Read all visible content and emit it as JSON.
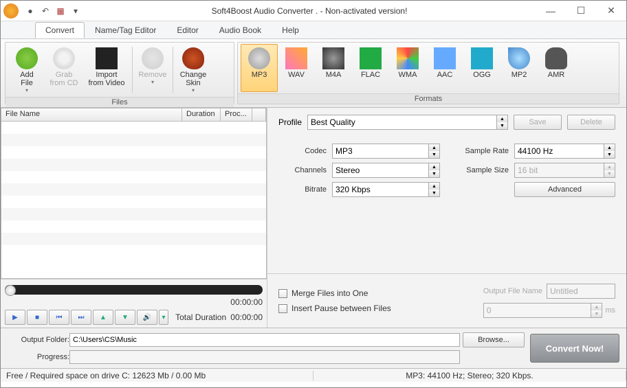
{
  "title": "Soft4Boost Audio Converter  . - Non-activated version!",
  "menu": {
    "tabs": [
      "Convert",
      "Name/Tag Editor",
      "Editor",
      "Audio Book",
      "Help"
    ],
    "active": 0
  },
  "ribbon": {
    "files_caption": "Files",
    "formats_caption": "Formats",
    "add_file": "Add\nFile",
    "grab_cd": "Grab\nfrom CD",
    "import_video": "Import\nfrom Video",
    "remove": "Remove",
    "change_skin": "Change\nSkin",
    "formats": [
      "MP3",
      "WAV",
      "M4A",
      "FLAC",
      "WMA",
      "AAC",
      "OGG",
      "MP2",
      "AMR"
    ],
    "selected_format": "MP3"
  },
  "filelist": {
    "col_name": "File Name",
    "col_duration": "Duration",
    "col_proc": "Proc..."
  },
  "playback": {
    "time": "00:00:00",
    "total_label": "Total Duration",
    "total_time": "00:00:00"
  },
  "settings": {
    "profile_label": "Profile",
    "profile_value": "Best Quality",
    "save": "Save",
    "delete": "Delete",
    "codec_label": "Codec",
    "codec_value": "MP3",
    "sample_rate_label": "Sample Rate",
    "sample_rate_value": "44100 Hz",
    "channels_label": "Channels",
    "channels_value": "Stereo",
    "sample_size_label": "Sample Size",
    "sample_size_value": "16 bit",
    "bitrate_label": "Bitrate",
    "bitrate_value": "320 Kbps",
    "advanced": "Advanced"
  },
  "options": {
    "merge": "Merge Files into One",
    "insert_pause": "Insert Pause between Files",
    "output_name_label": "Output File Name",
    "output_name_value": "Untitled",
    "pause_value": "0",
    "pause_unit": "ms"
  },
  "bottom": {
    "output_folder_label": "Output Folder:",
    "output_folder_value": "C:\\Users\\CS\\Music",
    "browse": "Browse...",
    "progress_label": "Progress:",
    "convert": "Convert Now!"
  },
  "status": {
    "space": "Free / Required space on drive  C: 12623 Mb / 0.00 Mb",
    "format": "MP3: 44100  Hz; Stereo; 320 Kbps."
  }
}
